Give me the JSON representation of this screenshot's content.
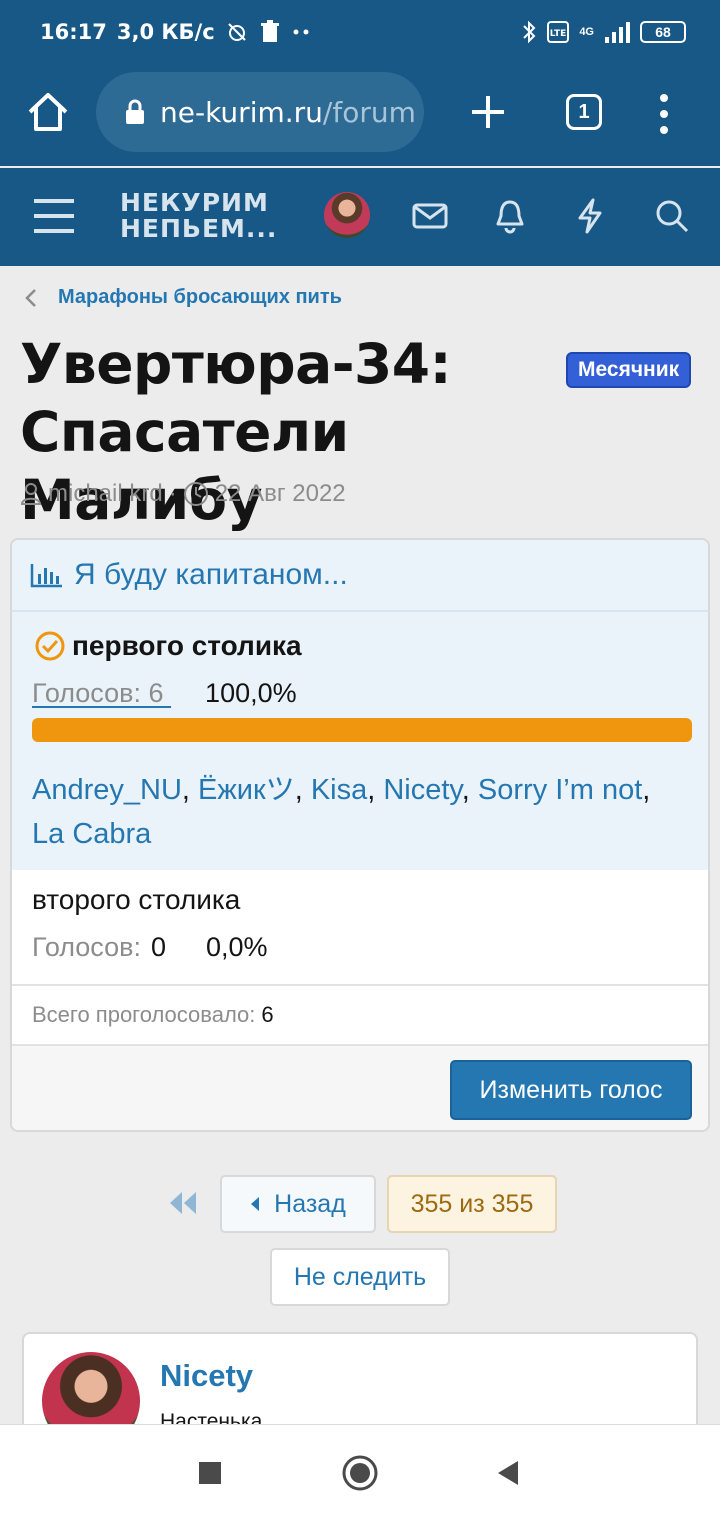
{
  "status_bar": {
    "time": "16:17",
    "speed": "3,0 КБ/с",
    "network": "4G",
    "battery": "68"
  },
  "browser": {
    "url_domain": "ne-kurim.ru",
    "url_path": "/forum",
    "tabs_count": "1"
  },
  "site": {
    "logo_line1": "НЕКУРИМ",
    "logo_line2": "НЕПЬЕМ..."
  },
  "breadcrumb": "Марафоны бросающих пить",
  "thread": {
    "title": "Увертюра-34: Спасатели Малибу",
    "prefix": "Месячник",
    "author": "michail krd",
    "separator": "·",
    "date": "22 Авг 2022"
  },
  "poll": {
    "question": "Я буду капитаном...",
    "votes_label": "Голосов:",
    "responses": [
      {
        "label": "первого столика",
        "votes": "6",
        "percent": "100,0%",
        "fraction": 1.0,
        "voters": [
          "Andrey_NU",
          "Ёжикツ",
          "Kisa",
          "Nicety",
          "Sorry I’m not",
          "La Cabra"
        ]
      },
      {
        "label": "второго столика",
        "votes": "0",
        "percent": "0,0%",
        "fraction": 0.0
      }
    ],
    "total_label": "Всего проголосовало:",
    "total": "6",
    "change_button": "Изменить голос"
  },
  "pagination": {
    "back": "Назад",
    "page_count": "355 из 355",
    "unwatch": "Не следить"
  },
  "post": {
    "username": "Nicety",
    "user_title": "Настенька"
  },
  "colors": {
    "header": "#185886",
    "link": "#2577b1",
    "poll_bar": "#f0960e",
    "prefix": "#3360d6"
  }
}
